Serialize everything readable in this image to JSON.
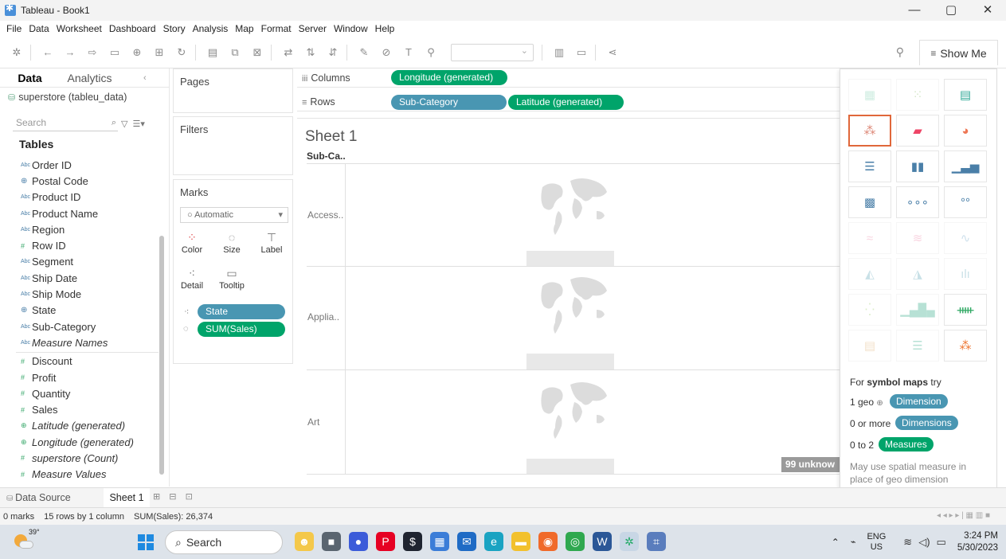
{
  "window": {
    "title": "Tableau - Book1",
    "controls": [
      "—",
      "▢",
      "✕"
    ]
  },
  "menu": [
    "File",
    "Data",
    "Worksheet",
    "Dashboard",
    "Story",
    "Analysis",
    "Map",
    "Format",
    "Server",
    "Window",
    "Help"
  ],
  "toolbar": {
    "show_me_label": "Show Me"
  },
  "data_pane": {
    "tabs": [
      "Data",
      "Analytics"
    ],
    "datasource": "superstore (tableu_data)",
    "search_placeholder": "Search",
    "tables_heading": "Tables",
    "dimensions": [
      {
        "type": "Abc",
        "name": "Order ID"
      },
      {
        "type": "geo",
        "name": "Postal Code"
      },
      {
        "type": "Abc",
        "name": "Product ID"
      },
      {
        "type": "Abc",
        "name": "Product Name"
      },
      {
        "type": "Abc",
        "name": "Region"
      },
      {
        "type": "#",
        "name": "Row ID"
      },
      {
        "type": "Abc",
        "name": "Segment"
      },
      {
        "type": "Abc",
        "name": "Ship Date"
      },
      {
        "type": "Abc",
        "name": "Ship Mode"
      },
      {
        "type": "geo",
        "name": "State"
      },
      {
        "type": "Abc",
        "name": "Sub-Category"
      },
      {
        "type": "Abc",
        "name": "Measure Names",
        "italic": true
      }
    ],
    "measures": [
      {
        "type": "#",
        "name": "Discount"
      },
      {
        "type": "#",
        "name": "Profit"
      },
      {
        "type": "#",
        "name": "Quantity"
      },
      {
        "type": "#",
        "name": "Sales"
      },
      {
        "type": "geo",
        "name": "Latitude (generated)",
        "italic": true
      },
      {
        "type": "geo",
        "name": "Longitude (generated)",
        "italic": true
      },
      {
        "type": "#",
        "name": "superstore (Count)",
        "italic": true
      },
      {
        "type": "#",
        "name": "Measure Values",
        "italic": true
      }
    ]
  },
  "cards": {
    "pages": "Pages",
    "filters": "Filters",
    "marks": {
      "title": "Marks",
      "mark_type": "○ Automatic",
      "buttons": [
        "Color",
        "Size",
        "Label",
        "Detail",
        "Tooltip"
      ],
      "pills": [
        {
          "label": "State",
          "kind": "dimension"
        },
        {
          "label": "SUM(Sales)",
          "kind": "measure"
        }
      ]
    }
  },
  "shelves": {
    "columns_label": "Columns",
    "rows_label": "Rows",
    "columns_pills": [
      "Longitude (generated)"
    ],
    "rows_pills": [
      "Sub-Category",
      "Latitude (generated)"
    ]
  },
  "view": {
    "sheet_title": "Sheet 1",
    "row_header": "Sub-Ca..",
    "rows": [
      "Access..",
      "Applia..",
      "Art"
    ],
    "unknown_indicator": "99 unknow"
  },
  "show_me": {
    "hint_prefix": "For ",
    "hint_bold": "symbol maps",
    "hint_suffix": " try",
    "req1_prefix": "1 geo",
    "req1_pill": "Dimension",
    "req2_prefix": "0 or more",
    "req2_pill": "Dimensions",
    "req3_prefix": "0 to 2",
    "req3_pill": "Measures",
    "note": "May use spatial measure in place of geo dimension"
  },
  "tabs": {
    "data_source": "Data Source",
    "sheet": "Sheet 1"
  },
  "status": {
    "marks": "0 marks",
    "dims": "15 rows by 1 column",
    "sum": "SUM(Sales): 26,374"
  },
  "taskbar": {
    "temperature": "39°",
    "search_label": "Search",
    "lang_top": "ENG",
    "lang_bottom": "US",
    "time": "3:24 PM",
    "date": "5/30/2023"
  },
  "colors": {
    "dimension_pill": "#4996b2",
    "measure_pill": "#00a46a",
    "selected_chart": "#e0673a"
  }
}
